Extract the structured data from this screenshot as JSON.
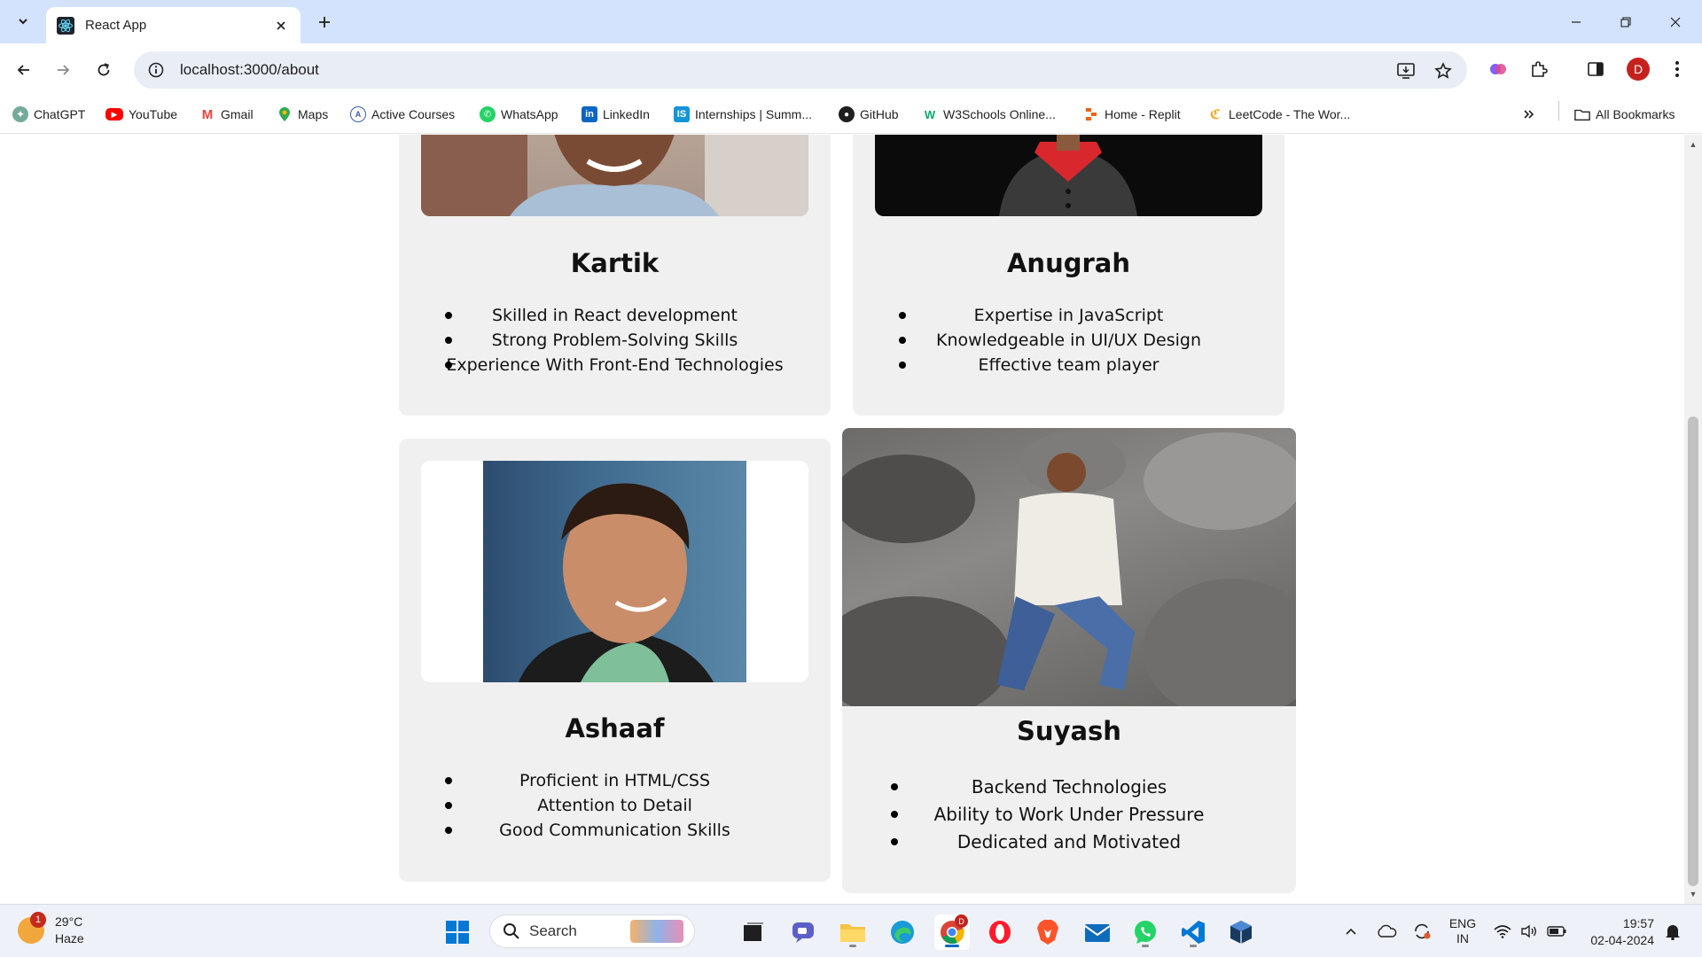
{
  "browser": {
    "tab_title": "React App",
    "url": "localhost:3000/about",
    "profile_initial": "D",
    "bookmarks": [
      {
        "label": "ChatGPT",
        "icon": "chatgpt-icon",
        "color": "#74aa9c"
      },
      {
        "label": "YouTube",
        "icon": "youtube-icon",
        "color": "#ff0000"
      },
      {
        "label": "Gmail",
        "icon": "gmail-icon",
        "color": "#ea4335"
      },
      {
        "label": "Maps",
        "icon": "maps-icon",
        "color": "#34a853"
      },
      {
        "label": "Active Courses",
        "icon": "courses-icon",
        "color": "#3b5bab"
      },
      {
        "label": "WhatsApp",
        "icon": "whatsapp-icon",
        "color": "#25d366"
      },
      {
        "label": "LinkedIn",
        "icon": "linkedin-icon",
        "color": "#0a66c2"
      },
      {
        "label": "Internships | Summ...",
        "icon": "internshala-icon",
        "color": "#1295d8"
      },
      {
        "label": "GitHub",
        "icon": "github-icon",
        "color": "#1f1f1f"
      },
      {
        "label": "W3Schools Online...",
        "icon": "w3schools-icon",
        "color": "#04aa6d"
      },
      {
        "label": "Home - Replit",
        "icon": "replit-icon",
        "color": "#f26207"
      },
      {
        "label": "LeetCode - The Wor...",
        "icon": "leetcode-icon",
        "color": "#ffa116"
      }
    ],
    "all_bookmarks_label": "All Bookmarks"
  },
  "team": [
    {
      "name": "Kartik",
      "skills": [
        "Skilled in React development",
        "Strong Problem-Solving Skills",
        "Experience With Front-End Technologies"
      ]
    },
    {
      "name": "Anugrah",
      "skills": [
        "Expertise in JavaScript",
        "Knowledgeable in UI/UX Design",
        "Effective team player"
      ]
    },
    {
      "name": "Ashaaf",
      "skills": [
        "Proficient in HTML/CSS",
        "Attention to Detail",
        "Good Communication Skills"
      ]
    },
    {
      "name": "Suyash",
      "skills": [
        "Backend Technologies",
        "Ability to Work Under Pressure",
        "Dedicated and Motivated"
      ]
    }
  ],
  "taskbar": {
    "weather_temp": "29°C",
    "weather_desc": "Haze",
    "weather_badge": "1",
    "search_placeholder": "Search",
    "chrome_badge": "D",
    "lang_top": "ENG",
    "lang_bottom": "IN",
    "time": "19:57",
    "date": "02-04-2024"
  }
}
